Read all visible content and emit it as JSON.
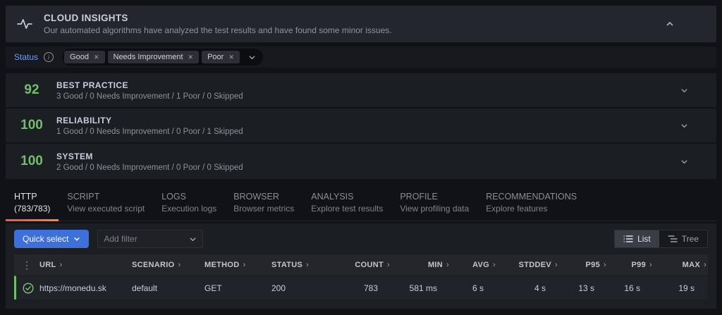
{
  "header": {
    "title": "CLOUD INSIGHTS",
    "subtitle": "Our automated algorithms have analyzed the test results and have found some minor issues."
  },
  "status_filter": {
    "label": "Status",
    "tags": [
      "Good",
      "Needs Improvement",
      "Poor"
    ]
  },
  "insights": [
    {
      "score": "92",
      "title": "BEST PRACTICE",
      "summary": "3 Good / 0 Needs Improvement / 1 Poor / 0 Skipped"
    },
    {
      "score": "100",
      "title": "RELIABILITY",
      "summary": "1 Good / 0 Needs Improvement / 0 Poor / 1 Skipped"
    },
    {
      "score": "100",
      "title": "SYSTEM",
      "summary": "2 Good / 0 Needs Improvement / 0 Poor / 0 Skipped"
    }
  ],
  "tabs": [
    {
      "label": "HTTP",
      "sublabel": "(783/783)",
      "active": true
    },
    {
      "label": "SCRIPT",
      "sublabel": "View executed script",
      "active": false
    },
    {
      "label": "LOGS",
      "sublabel": "Execution logs",
      "active": false
    },
    {
      "label": "BROWSER",
      "sublabel": "Browser metrics",
      "active": false
    },
    {
      "label": "ANALYSIS",
      "sublabel": "Explore test results",
      "active": false
    },
    {
      "label": "PROFILE",
      "sublabel": "View profiling data",
      "active": false
    },
    {
      "label": "RECOMMENDATIONS",
      "sublabel": "Explore features",
      "active": false
    }
  ],
  "toolbar": {
    "quick_select_label": "Quick select",
    "add_filter_placeholder": "Add filter",
    "view_toggle": {
      "list_label": "List",
      "tree_label": "Tree",
      "selected": "List"
    }
  },
  "table": {
    "columns": [
      "URL",
      "SCENARIO",
      "METHOD",
      "STATUS",
      "COUNT",
      "MIN",
      "AVG",
      "STDDEV",
      "P95",
      "P99",
      "MAX"
    ],
    "rows": [
      {
        "url": "https://monedu.sk",
        "scenario": "default",
        "method": "GET",
        "status": "200",
        "count": "783",
        "min": "581 ms",
        "avg": "6 s",
        "stddev": "4 s",
        "p95": "13 s",
        "p99": "16 s",
        "max": "19 s",
        "status_ok": true
      }
    ]
  },
  "icons": {
    "kebab": "⋮",
    "close": "✕",
    "sort_chevron": "›",
    "info": "i"
  },
  "colors": {
    "accent_orange": "#ff780a",
    "score_green": "#73bf69",
    "primary_button_blue": "#3d71d9",
    "link_blue": "#6e9fff"
  }
}
